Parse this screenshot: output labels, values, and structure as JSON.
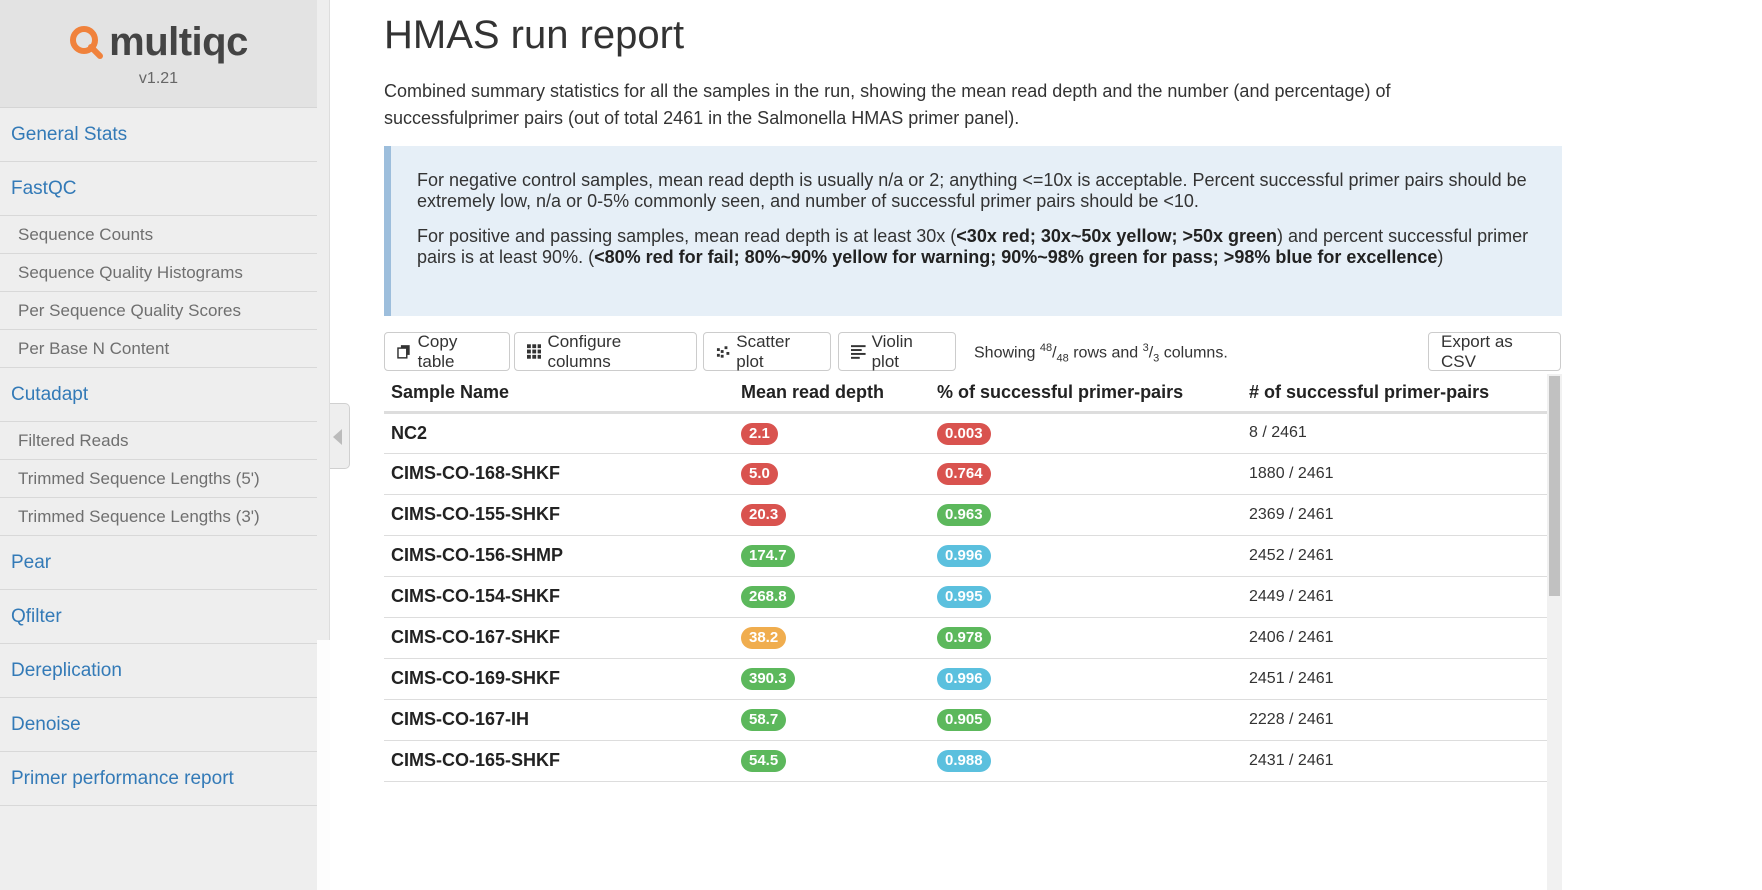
{
  "app": {
    "name": "multiqc",
    "version": "v1.21"
  },
  "sidebar": {
    "items": [
      {
        "label": "General Stats",
        "level": "top"
      },
      {
        "label": "FastQC",
        "level": "top"
      },
      {
        "label": "Sequence Counts",
        "level": "sub"
      },
      {
        "label": "Sequence Quality Histograms",
        "level": "sub"
      },
      {
        "label": "Per Sequence Quality Scores",
        "level": "sub"
      },
      {
        "label": "Per Base N Content",
        "level": "sub"
      },
      {
        "label": "Cutadapt",
        "level": "top"
      },
      {
        "label": "Filtered Reads",
        "level": "sub"
      },
      {
        "label": "Trimmed Sequence Lengths (5')",
        "level": "sub"
      },
      {
        "label": "Trimmed Sequence Lengths (3')",
        "level": "sub"
      },
      {
        "label": "Pear",
        "level": "top"
      },
      {
        "label": "Qfilter",
        "level": "top"
      },
      {
        "label": "Dereplication",
        "level": "top"
      },
      {
        "label": "Denoise",
        "level": "top"
      },
      {
        "label": "Primer performance report",
        "level": "top"
      }
    ]
  },
  "main": {
    "title": "HMAS run report",
    "description": "Combined summary statistics for all the samples in the run, showing the mean read depth and the number (and percentage) of successfulprimer pairs (out of total 2461 in the Salmonella HMAS primer panel).",
    "callout": {
      "p1": "For negative control samples, mean read depth is usually n/a or 2; anything <=10x is acceptable. Percent successful primer pairs should be extremely low, n/a or 0-5% commonly seen, and number of successful primer pairs should be <10.",
      "p2_a": "For positive and passing samples, mean read depth is at least 30x (",
      "p2_b": "<30x red; 30x~50x yellow; >50x green",
      "p2_c": ") and percent successful primer pairs is at least 90%. (",
      "p2_d": "<80% red for fail; 80%~90% yellow for warning; 90%~98% green for pass; >98% blue for excellence",
      "p2_e": ")"
    }
  },
  "toolbar": {
    "copy": "Copy table",
    "configure": "Configure columns",
    "scatter": "Scatter plot",
    "violin": "Violin plot",
    "showing_a": "Showing ",
    "rows_shown": "48",
    "rows_total": "48",
    "showing_b": " rows and ",
    "cols_shown": "3",
    "cols_total": "3",
    "showing_c": " columns.",
    "export": "Export as CSV"
  },
  "table": {
    "headers": [
      "Sample Name",
      "Mean read depth",
      "% of successful primer-pairs",
      "# of successful primer-pairs"
    ],
    "rows": [
      {
        "name": "NC2",
        "depth": "2.1",
        "depth_color": "red",
        "pct": "0.003",
        "pct_color": "red",
        "count": "8 / 2461"
      },
      {
        "name": "CIMS-CO-168-SHKF",
        "depth": "5.0",
        "depth_color": "red",
        "pct": "0.764",
        "pct_color": "red",
        "count": "1880 / 2461"
      },
      {
        "name": "CIMS-CO-155-SHKF",
        "depth": "20.3",
        "depth_color": "red",
        "pct": "0.963",
        "pct_color": "green",
        "count": "2369 / 2461"
      },
      {
        "name": "CIMS-CO-156-SHMP",
        "depth": "174.7",
        "depth_color": "green",
        "pct": "0.996",
        "pct_color": "blue",
        "count": "2452 / 2461"
      },
      {
        "name": "CIMS-CO-154-SHKF",
        "depth": "268.8",
        "depth_color": "green",
        "pct": "0.995",
        "pct_color": "blue",
        "count": "2449 / 2461"
      },
      {
        "name": "CIMS-CO-167-SHKF",
        "depth": "38.2",
        "depth_color": "yellow",
        "pct": "0.978",
        "pct_color": "green",
        "count": "2406 / 2461"
      },
      {
        "name": "CIMS-CO-169-SHKF",
        "depth": "390.3",
        "depth_color": "green",
        "pct": "0.996",
        "pct_color": "blue",
        "count": "2451 / 2461"
      },
      {
        "name": "CIMS-CO-167-IH",
        "depth": "58.7",
        "depth_color": "green",
        "pct": "0.905",
        "pct_color": "green",
        "count": "2228 / 2461"
      },
      {
        "name": "CIMS-CO-165-SHKF",
        "depth": "54.5",
        "depth_color": "green",
        "pct": "0.988",
        "pct_color": "blue",
        "count": "2431 / 2461"
      }
    ]
  },
  "colors": {
    "red": "#d9534f",
    "green": "#5cb85c",
    "yellow": "#f0ad4e",
    "blue": "#5bc0de",
    "link": "#337ab7"
  }
}
